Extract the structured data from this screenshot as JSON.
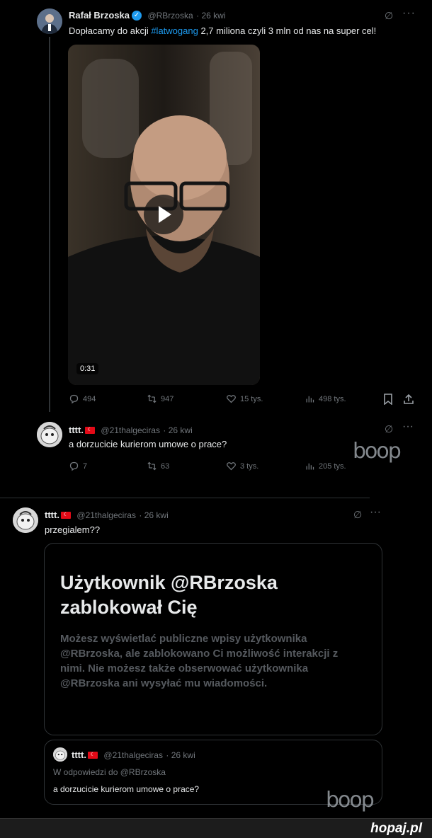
{
  "tweet1": {
    "author_name": "Rafał Brzoska",
    "handle": "@RBrzoska",
    "date": "26 kwi",
    "text_before": "Dopłacamy do akcji ",
    "hashtag": "#latwogang",
    "text_after": " 2,7 miliona czyli 3 mln od nas na super cel!",
    "video_duration": "0:31",
    "replies": "494",
    "reposts": "947",
    "likes": "15 tys.",
    "views": "498 tys."
  },
  "reply1": {
    "author_name": "tttt.",
    "handle": "@21thalgeciras",
    "date": "26 kwi",
    "text": "a dorzucicie kurierom umowe o prace?",
    "replies": "7",
    "reposts": "63",
    "likes": "3 tys.",
    "views": "205 tys.",
    "watermark": "boop"
  },
  "tweet2": {
    "author_name": "tttt.",
    "handle": "@21thalgeciras",
    "date": "26 kwi",
    "text": "przegialem??",
    "blocked_title": "Użytkownik @RBrzoska zablokował Cię",
    "blocked_body": "Możesz wyświetlać publiczne wpisy użytkownika @RBrzoska, ale zablokowano Ci możliwość interakcji z nimi. Nie możesz także obserwować użytkownika @RBrzoska ani wysyłać mu wiadomości.",
    "quote_author": "tttt.",
    "quote_handle": "@21thalgeciras",
    "quote_date": "26 kwi",
    "quote_reply_to": "W odpowiedzi do @RBrzoska",
    "quote_text": "a dorzucicie kurierom umowe o prace?",
    "watermark": "boop"
  },
  "footer": {
    "site": "hopaj.pl"
  },
  "colors": {
    "background": "#000000",
    "accent": "#1d9bf0",
    "muted": "#71767b",
    "footer_bg": "#1c1c1c",
    "footer_text": "#ffffff"
  }
}
